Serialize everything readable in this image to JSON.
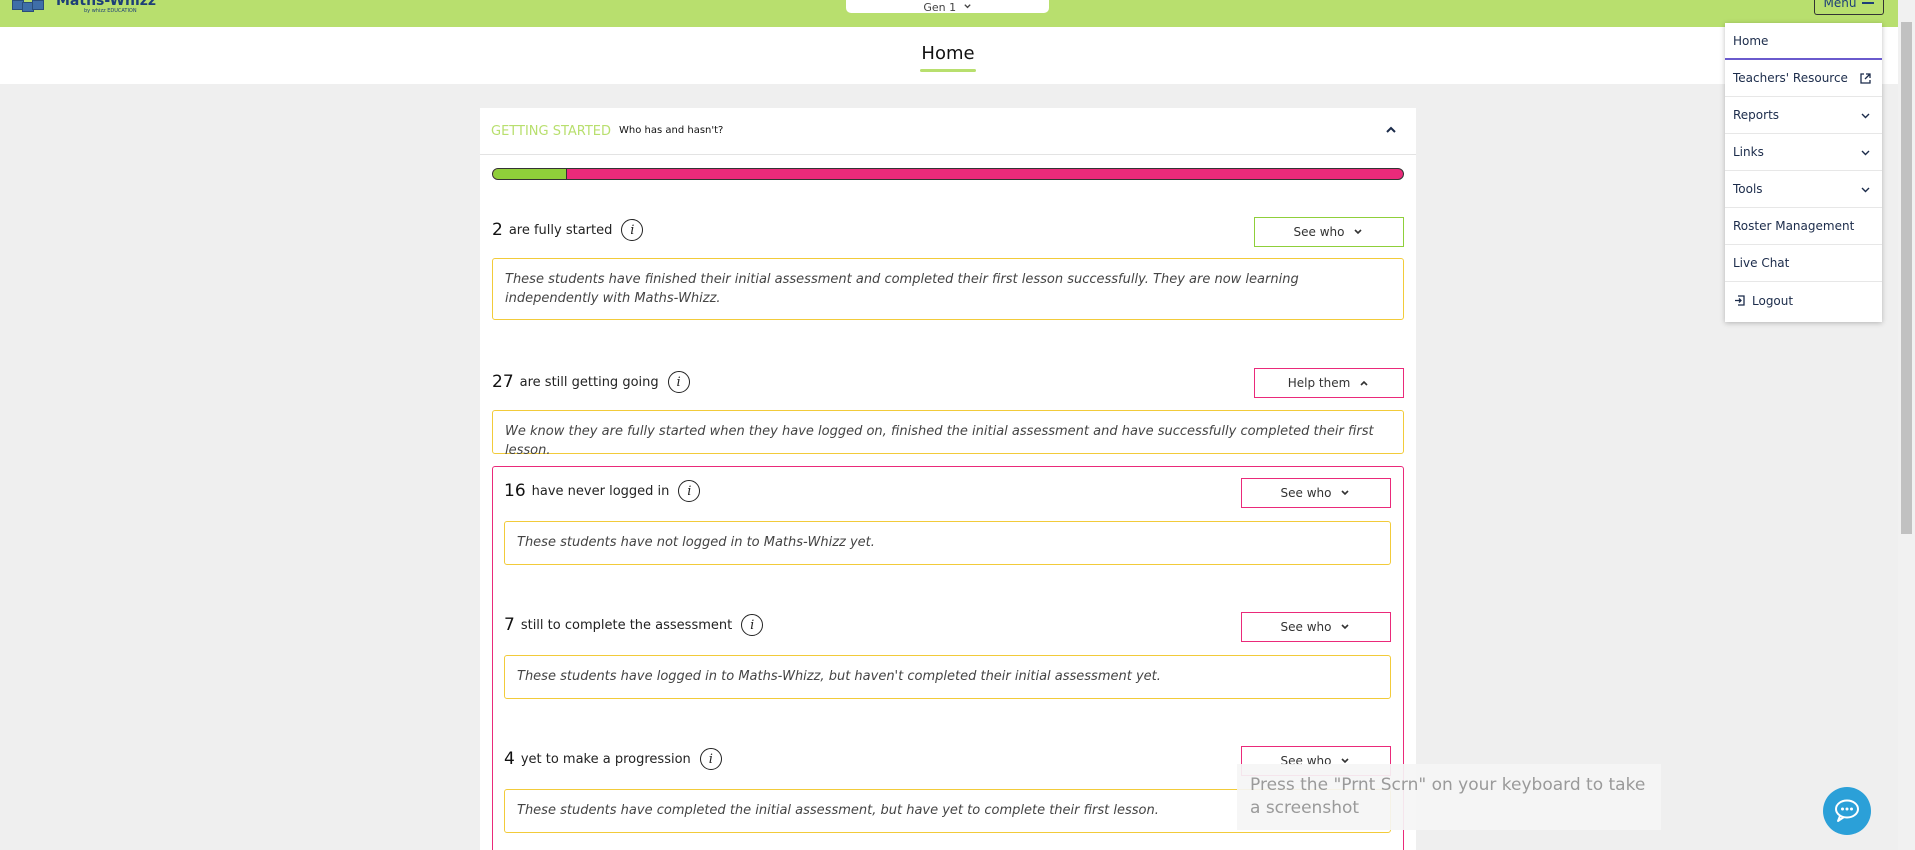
{
  "header": {
    "logo_main": "Maths-Whizz",
    "logo_sub": "by whizz EDUCATION",
    "class_select": "Gen 1",
    "menu_label": "Menu"
  },
  "page_title": "Home",
  "getting_started": {
    "title": "GETTING STARTED",
    "subtitle": "Who has and hasn't?",
    "progress_fraction": 0.081,
    "fully_started": {
      "count": "2",
      "label": "are fully started",
      "button": "See who",
      "note": "These students have finished their initial assessment and completed their first lesson successfully. They are now learning independently with Maths-Whizz."
    },
    "getting_going": {
      "count": "27",
      "label": "are still getting going",
      "button": "Help them",
      "note": "We know they are fully started when they have logged on, finished the initial assessment and have successfully completed their first lesson."
    },
    "sub_groups": [
      {
        "count": "16",
        "label": "have never logged in",
        "button": "See who",
        "note": "These students have not logged in to Maths-Whizz yet."
      },
      {
        "count": "7",
        "label": "still to complete the assessment",
        "button": "See who",
        "note": "These students have logged in to Maths-Whizz, but haven't completed their initial assessment yet."
      },
      {
        "count": "4",
        "label": "yet to make a progression",
        "button": "See who",
        "note": "These students have completed the initial assessment, but have yet to complete their first lesson."
      }
    ]
  },
  "menu": {
    "items": [
      {
        "label": "Home"
      },
      {
        "label": "Teachers' Resource"
      },
      {
        "label": "Reports"
      },
      {
        "label": "Links"
      },
      {
        "label": "Tools"
      },
      {
        "label": "Roster Management"
      },
      {
        "label": "Live Chat"
      },
      {
        "label": "Logout"
      }
    ]
  },
  "toast": "Press the \"Prnt Scrn\" on your keyboard to take a screenshot",
  "colors": {
    "brand_green": "#b8df6e",
    "progress_green": "#8fcf3a",
    "pink": "#ea2a7a",
    "note_border": "#f2cb3a"
  }
}
